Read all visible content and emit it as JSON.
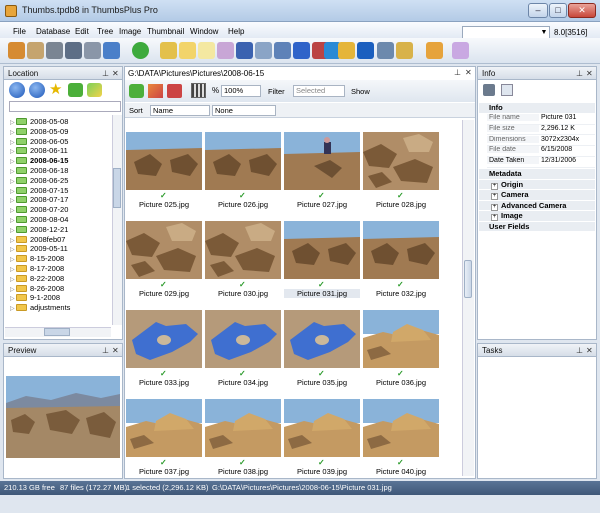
{
  "window": {
    "title": "Thumbs.tpdb8 in ThumbsPlus Pro",
    "minimize": "–",
    "maximize": "□",
    "close": "✕"
  },
  "menu": [
    "File",
    "Database",
    "Edit",
    "Tree",
    "Image",
    "Thumbnail",
    "Window",
    "Help"
  ],
  "zoom_right": "8.0[3516]",
  "location": {
    "title": "Location",
    "tree": [
      {
        "label": "2008-05-08",
        "bold": false
      },
      {
        "label": "2008-05-09",
        "bold": false
      },
      {
        "label": "2008-06-05",
        "bold": false
      },
      {
        "label": "2008-06-11",
        "bold": false
      },
      {
        "label": "2008-06-15",
        "bold": true
      },
      {
        "label": "2008-06-18",
        "bold": false
      },
      {
        "label": "2008-06-25",
        "bold": false
      },
      {
        "label": "2008-07-15",
        "bold": false
      },
      {
        "label": "2008-07-17",
        "bold": false
      },
      {
        "label": "2008-07-20",
        "bold": false
      },
      {
        "label": "2008-08-04",
        "bold": false
      },
      {
        "label": "2008-12-21",
        "bold": false
      },
      {
        "label": "2008feb07",
        "bold": false
      },
      {
        "label": "2009-05-11",
        "bold": false
      },
      {
        "label": "8-15-2008",
        "bold": false
      },
      {
        "label": "8-17-2008",
        "bold": false
      },
      {
        "label": "8-22-2008",
        "bold": false
      },
      {
        "label": "8-26-2008",
        "bold": false
      },
      {
        "label": "9-1-2008",
        "bold": false
      },
      {
        "label": "adjustments",
        "bold": false
      }
    ]
  },
  "preview": {
    "title": "Preview"
  },
  "main": {
    "path": "G:\\DATA\\Pictures\\Pictures\\2008-06-15",
    "zoom_value": "100%",
    "filter_label": "Filter",
    "selected_label": "Selected",
    "show_label": "Show",
    "sort_label": "Sort",
    "sort_field": "Name",
    "sort_second": "None",
    "check": "✓",
    "thumbs": [
      {
        "name": "Picture 025.jpg",
        "scene": "rock-sky"
      },
      {
        "name": "Picture 026.jpg",
        "scene": "rock-sky"
      },
      {
        "name": "Picture 027.jpg",
        "scene": "person"
      },
      {
        "name": "Picture 028.jpg",
        "scene": "rock"
      },
      {
        "name": "Picture 029.jpg",
        "scene": "rock"
      },
      {
        "name": "Picture 030.jpg",
        "scene": "rock"
      },
      {
        "name": "Picture 031.jpg",
        "scene": "rock-sky",
        "selected": true
      },
      {
        "name": "Picture 032.jpg",
        "scene": "rock-sky"
      },
      {
        "name": "Picture 033.jpg",
        "scene": "glove"
      },
      {
        "name": "Picture 034.jpg",
        "scene": "glove"
      },
      {
        "name": "Picture 035.jpg",
        "scene": "glove"
      },
      {
        "name": "Picture 036.jpg",
        "scene": "hill"
      },
      {
        "name": "Picture 037.jpg",
        "scene": "hill"
      },
      {
        "name": "Picture 038.jpg",
        "scene": "hill"
      },
      {
        "name": "Picture 039.jpg",
        "scene": "hill"
      },
      {
        "name": "Picture 040.jpg",
        "scene": "hill"
      }
    ]
  },
  "info": {
    "title": "Info",
    "section": "Info",
    "rows": [
      {
        "k": "File name",
        "v": "Picture 031"
      },
      {
        "k": "File size",
        "v": "2,296.12 K"
      },
      {
        "k": "Dimensions",
        "v": "3072x2304x"
      },
      {
        "k": "File date",
        "v": "6/15/2008"
      },
      {
        "k": "Date Taken",
        "v": "12/31/2006"
      }
    ],
    "meta_header": "Metadata",
    "meta": [
      "Origin",
      "Camera",
      "Advanced Camera",
      "Image"
    ],
    "user_fields": "User Fields"
  },
  "tasks": {
    "title": "Tasks"
  },
  "status": {
    "free": "210.13 GB free",
    "files": "87 files (172.27 MB)",
    "selected": "1 selected (2,296.12 KB)",
    "path": "G:\\DATA\\Pictures\\Pictures\\2008-06-15\\Picture 031.jpg"
  },
  "colors": {
    "accent": "#3f5878",
    "sky": "#8ab3d9",
    "rock": "#a07a52",
    "glove": "#3f6fd0",
    "check": "#2a9a2a"
  }
}
